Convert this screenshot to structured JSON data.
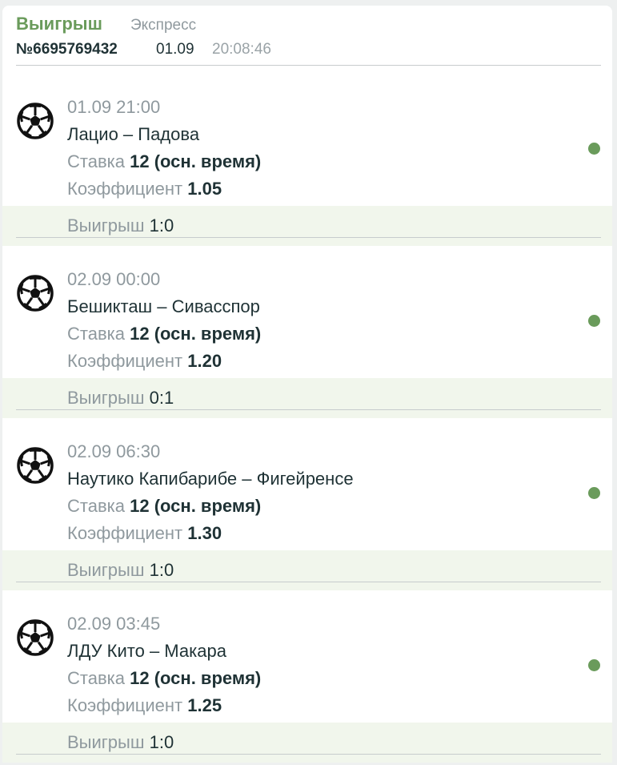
{
  "header": {
    "status": "Выигрыш",
    "type": "Экспресс",
    "number": "№6695769432",
    "date": "01.09",
    "time": "20:08:46"
  },
  "colors": {
    "win_green": "#6a9b5b",
    "result_bg": "#f1f6ec",
    "text_dark": "#1f3235",
    "text_muted": "#8f999e"
  },
  "events": [
    {
      "icon": "soccer-ball-icon",
      "datetime": "01.09 21:00",
      "match": "Лацио – Падова",
      "stake_label": "Ставка",
      "stake_value": "12 (осн. время)",
      "coef_label": "Коэффициент",
      "coef_value": "1.05",
      "result_label": "Выигрыш",
      "result_score": "1:0"
    },
    {
      "icon": "soccer-ball-icon",
      "datetime": "02.09 00:00",
      "match": "Бешикташ – Сивасспор",
      "stake_label": "Ставка",
      "stake_value": "12 (осн. время)",
      "coef_label": "Коэффициент",
      "coef_value": "1.20",
      "result_label": "Выигрыш",
      "result_score": "0:1"
    },
    {
      "icon": "soccer-ball-icon",
      "datetime": "02.09 06:30",
      "match": "Наутико Капибарибе – Фигейренсе",
      "stake_label": "Ставка",
      "stake_value": "12 (осн. время)",
      "coef_label": "Коэффициент",
      "coef_value": "1.30",
      "result_label": "Выигрыш",
      "result_score": "1:0"
    },
    {
      "icon": "soccer-ball-icon",
      "datetime": "02.09 03:45",
      "match": "ЛДУ Кито – Макара",
      "stake_label": "Ставка",
      "stake_value": "12 (осн. время)",
      "coef_label": "Коэффициент",
      "coef_value": "1.25",
      "result_label": "Выигрыш",
      "result_score": "1:0"
    }
  ]
}
